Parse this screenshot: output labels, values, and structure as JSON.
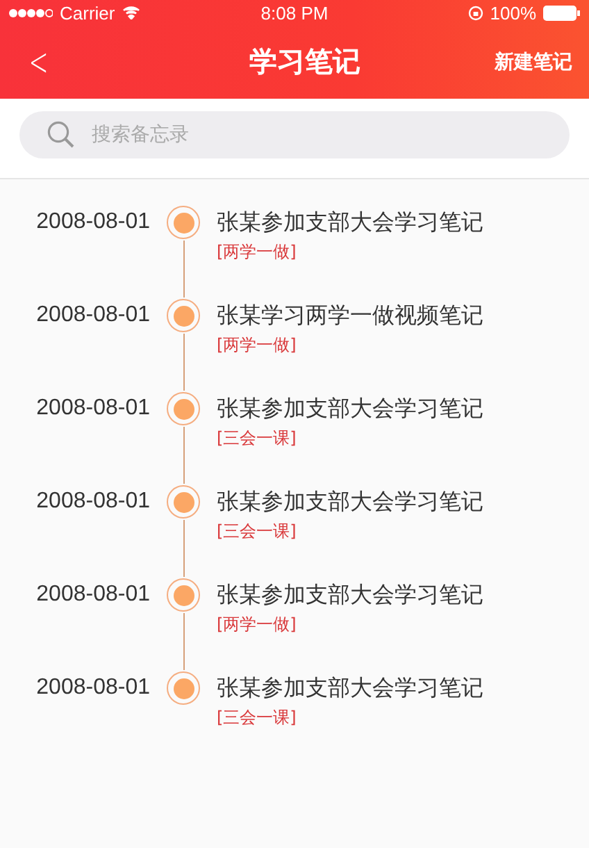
{
  "status_bar": {
    "carrier": "Carrier",
    "time": "8:08 PM",
    "battery": "100%"
  },
  "nav": {
    "back": "<",
    "title": "学习笔记",
    "action": "新建笔记"
  },
  "search": {
    "placeholder": "搜索备忘录"
  },
  "notes": [
    {
      "date": "2008-08-01",
      "title": "张某参加支部大会学习笔记",
      "tag": "[两学一做]"
    },
    {
      "date": "2008-08-01",
      "title": "张某学习两学一做视频笔记",
      "tag": "[两学一做]"
    },
    {
      "date": "2008-08-01",
      "title": "张某参加支部大会学习笔记",
      "tag": "[三会一课]"
    },
    {
      "date": "2008-08-01",
      "title": "张某参加支部大会学习笔记",
      "tag": "[三会一课]"
    },
    {
      "date": "2008-08-01",
      "title": "张某参加支部大会学习笔记",
      "tag": "[两学一做]"
    },
    {
      "date": "2008-08-01",
      "title": "张某参加支部大会学习笔记",
      "tag": "[三会一课]"
    }
  ]
}
